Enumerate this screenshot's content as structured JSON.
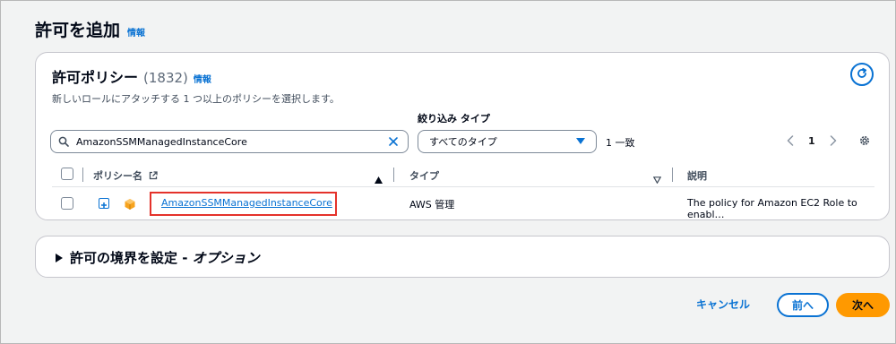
{
  "page": {
    "title": "許可を追加",
    "info_label": "情報"
  },
  "policies_panel": {
    "title": "許可ポリシー",
    "count": "(1832)",
    "info_label": "情報",
    "description": "新しいロールにアタッチする 1 つ以上のポリシーを選択します。",
    "search": {
      "value": "AmazonSSMManagedInstanceCore",
      "placeholder": "ポリシーを検索"
    },
    "filter": {
      "label": "絞り込み タイプ",
      "selected": "すべてのタイプ"
    },
    "match_count": "1 一致",
    "pagination": {
      "current_page": "1"
    },
    "table": {
      "columns": [
        "ポリシー名",
        "タイプ",
        "説明"
      ],
      "rows": [
        {
          "name": "AmazonSSMManagedInstanceCore",
          "type": "AWS 管理",
          "description": "The policy for Amazon EC2 Role to enabl…"
        }
      ]
    }
  },
  "boundary_panel": {
    "label": "許可の境界を設定 - ",
    "optional": "オプション"
  },
  "footer": {
    "cancel": "キャンセル",
    "previous": "前へ",
    "next": "次へ"
  },
  "colors": {
    "accent": "#0972d3",
    "primary_button": "#ff9900",
    "highlight": "#e4322b",
    "policy_icon": "#f7a31d"
  }
}
